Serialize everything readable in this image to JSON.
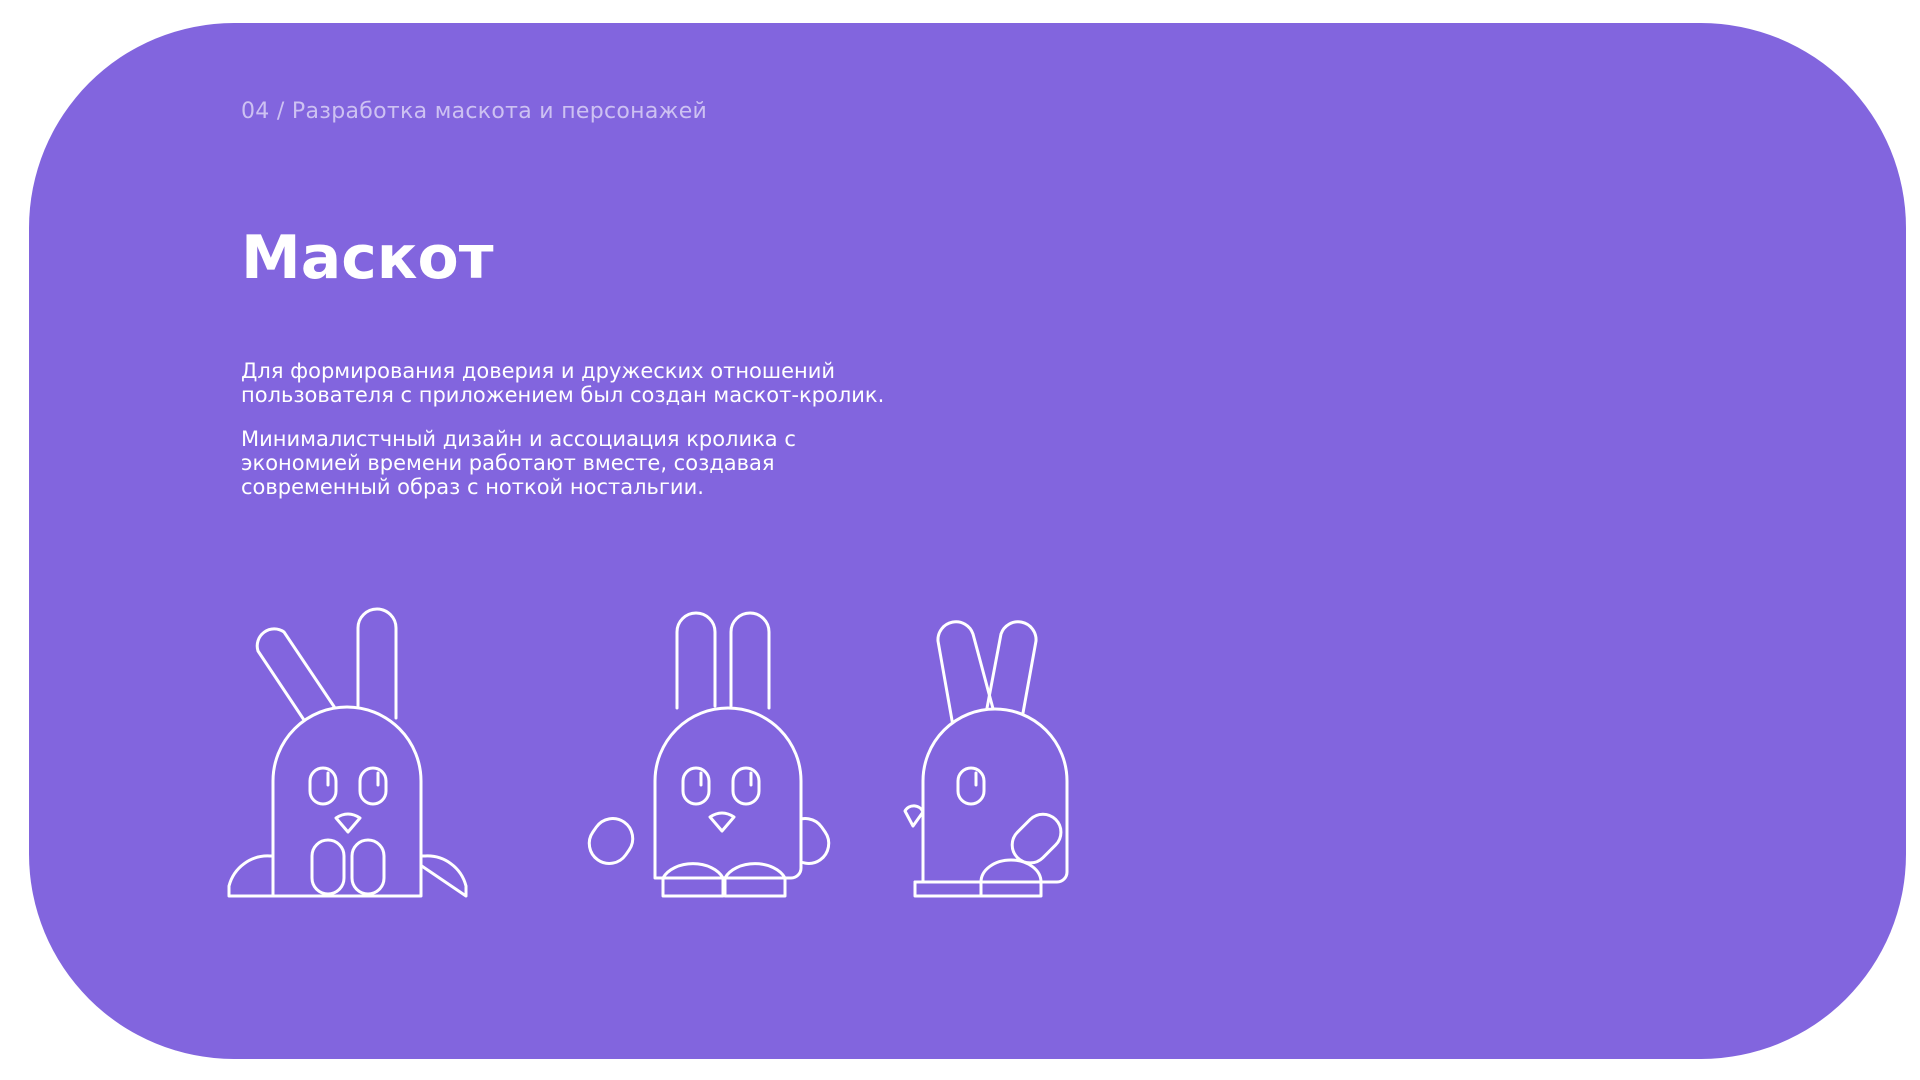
{
  "breadcrumb": "04 / Разработка маскота и персонажей",
  "title": "Маскот",
  "paragraphs": {
    "p1_line1": "Для формирования доверия и дружеских отношений",
    "p1_line2": "пользователя с приложением был создан маскот-кролик.",
    "p2_line1": "Минималистчный дизайн и ассоциация кролика с",
    "p2_line2": "экономией времени работают вместе, создавая",
    "p2_line3": "современный образ с ноткой ностальгии."
  },
  "colors": {
    "background": "#8265de",
    "foreground": "#ffffff",
    "page": "#ffffff"
  },
  "mascots": {
    "front_sitting": "rabbit-sitting-illustration",
    "front_standing": "rabbit-standing-illustration",
    "side_view": "rabbit-side-illustration"
  }
}
